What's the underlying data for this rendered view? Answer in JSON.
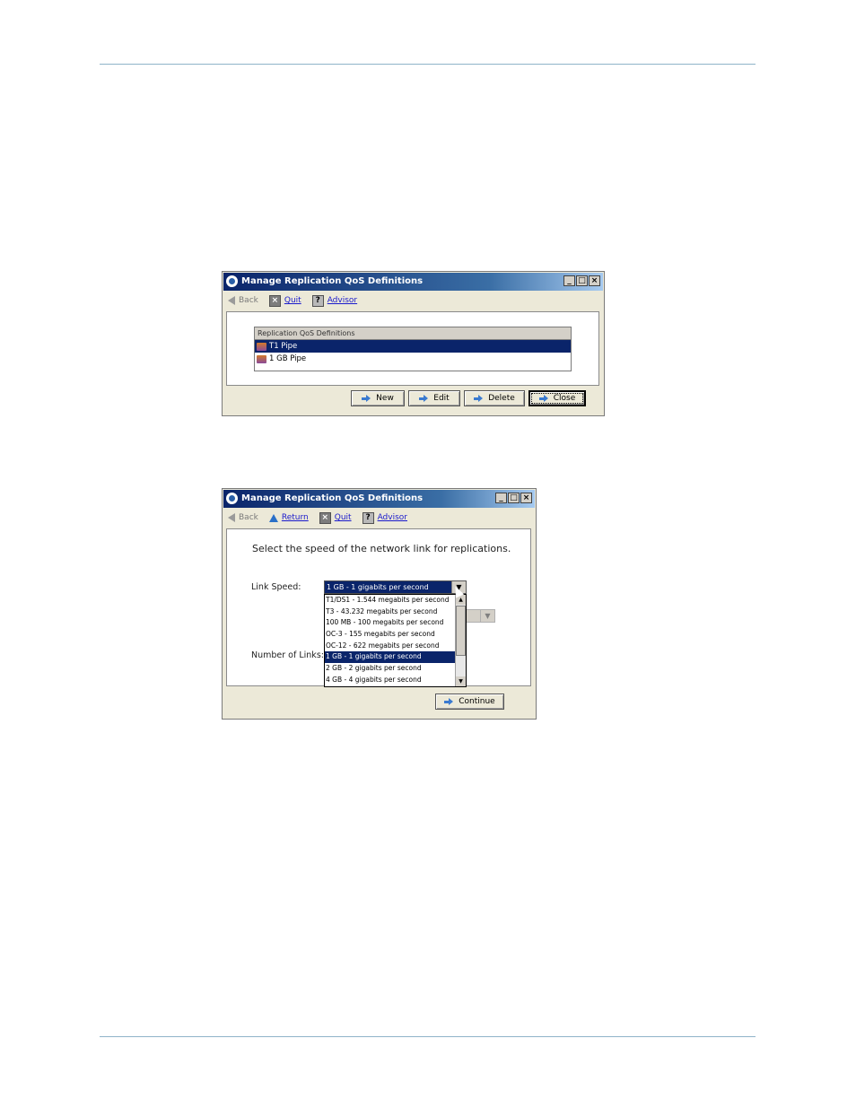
{
  "window1": {
    "title": "Manage Replication QoS Definitions",
    "window_buttons": {
      "minimize": "_",
      "maximize": "□",
      "close": "×"
    },
    "toolbar": {
      "back": "Back",
      "quit": "Quit",
      "advisor": "Advisor"
    },
    "table": {
      "header": "Replication QoS Definitions",
      "rows": [
        {
          "label": "T1 Pipe",
          "selected": true,
          "icon": "pipe-icon"
        },
        {
          "label": "1 GB Pipe",
          "selected": false,
          "icon": "pipe-icon"
        }
      ]
    },
    "buttons": {
      "new": "New",
      "edit": "Edit",
      "delete": "Delete",
      "close": "Close"
    }
  },
  "window2": {
    "title": "Manage Replication QoS Definitions",
    "window_buttons": {
      "minimize": "_",
      "maximize": "□",
      "close": "×"
    },
    "toolbar": {
      "back": "Back",
      "return": "Return",
      "quit": "Quit",
      "advisor": "Advisor"
    },
    "prompt": "Select the speed of the network link for replications.",
    "link_speed_label": "Link Speed:",
    "number_of_links_label": "Number of Links:",
    "link_speed_value": "1 GB - 1 gigabits per second",
    "dropdown_arrow": "▼",
    "options": [
      "T1/DS1 - 1.544 megabits per second",
      "T3 - 43.232 megabits per second",
      "100 MB - 100 megabits per second",
      "OC-3 - 155 megabits per second",
      "OC-12 - 622 megabits per second",
      "1 GB - 1 gigabits per second",
      "2 GB - 2 gigabits per second",
      "4 GB - 4 gigabits per second"
    ],
    "selected_option": "1 GB - 1 gigabits per second",
    "continue_button": "Continue"
  },
  "colors": {
    "titlebar": "#0a246a",
    "selection": "#0a246a",
    "rule": "#8fb3c9",
    "link": "#1a1acc"
  }
}
